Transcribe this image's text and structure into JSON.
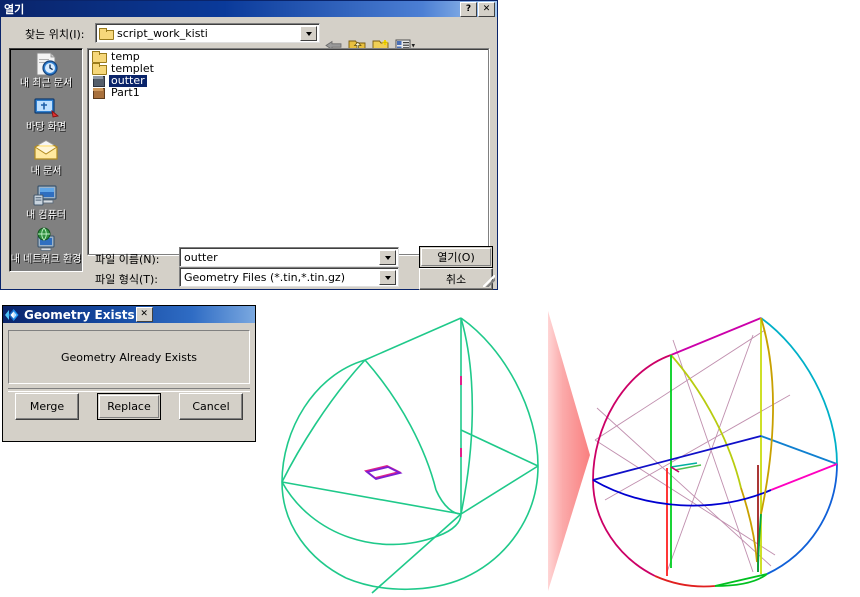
{
  "open_dialog": {
    "title": "열기",
    "help_button": "?",
    "close_button": "✕",
    "lookin_label": "찾는 위치(I):",
    "lookin_value": "script_work_kisti",
    "toolbar": [
      {
        "name": "back-icon",
        "tooltip": "뒤로"
      },
      {
        "name": "up-one-level-icon",
        "tooltip": "상위 폴더"
      },
      {
        "name": "new-folder-icon",
        "tooltip": "새 폴더 만들기"
      },
      {
        "name": "views-icon",
        "tooltip": "보기"
      }
    ],
    "places": [
      {
        "label": "내 최근 문서",
        "icon": "recent-documents-icon"
      },
      {
        "label": "바탕 화면",
        "icon": "desktop-icon"
      },
      {
        "label": "내 문서",
        "icon": "my-documents-icon"
      },
      {
        "label": "내 컴퓨터",
        "icon": "my-computer-icon"
      },
      {
        "label": "내 네트워크 환경",
        "icon": "network-places-icon"
      }
    ],
    "files": [
      {
        "name": "temp",
        "type": "folder",
        "selected": false
      },
      {
        "name": "templet",
        "type": "folder",
        "selected": false
      },
      {
        "name": "outter",
        "type": "geometry",
        "selected": true
      },
      {
        "name": "Part1",
        "type": "geometry",
        "selected": false
      }
    ],
    "filename_label": "파일 이름(N):",
    "filename_value": "outter",
    "filetype_label": "파일 형식(T):",
    "filetype_value": "Geometry Files (*.tin,*.tin.gz)",
    "open_button": "열기(O)",
    "cancel_button": "취소"
  },
  "geometry_dialog": {
    "title": "Geometry Exists",
    "close_button": "✕",
    "message": "Geometry Already Exists",
    "buttons": [
      {
        "label": "Merge",
        "default": false
      },
      {
        "label": "Replace",
        "default": true
      },
      {
        "label": "Cancel",
        "default": false
      }
    ]
  },
  "viewports": {
    "left": {
      "name": "single-color-geometry-view",
      "edge_color": "#1fc98a",
      "detail_color": "#7b1fd4",
      "accent_color": "#e0218a"
    },
    "right": {
      "name": "multi-color-geometry-view",
      "edge_colors": [
        "#cc0066",
        "#00b0c8",
        "#c8dd10",
        "#00b050",
        "#0000d0",
        "#ff2020",
        "#ff00c0",
        "#b87ba0",
        "#cc9900"
      ]
    },
    "arrow": {
      "name": "transition-arrow",
      "color": "#f98b8b"
    }
  }
}
